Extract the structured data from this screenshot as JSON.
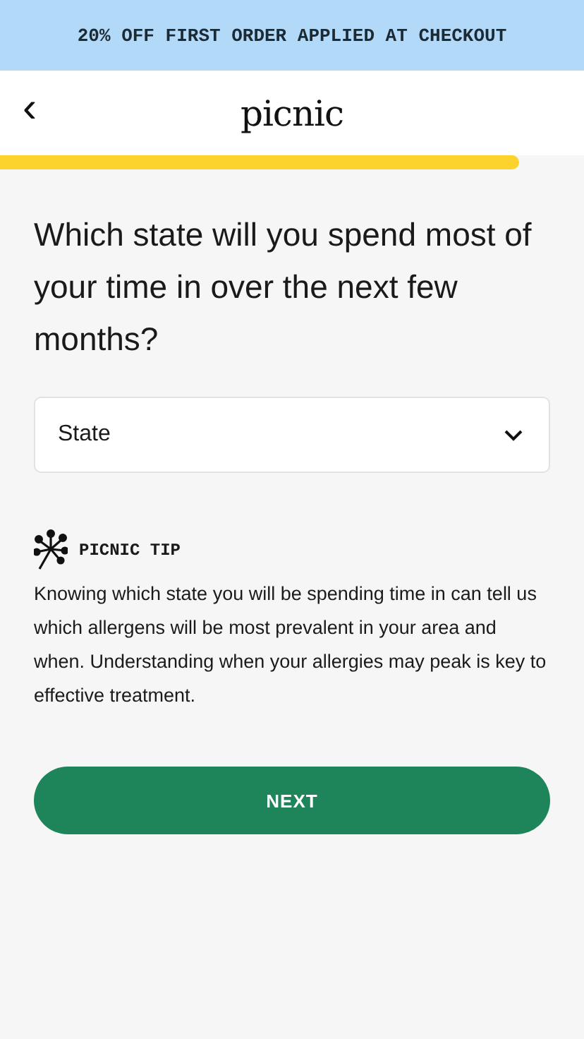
{
  "promo_banner": {
    "text": "20% OFF FIRST ORDER APPLIED AT CHECKOUT"
  },
  "header": {
    "back": "‹",
    "logo": "picnic"
  },
  "progress": {
    "level": 0.89
  },
  "question": "Which state will you spend most of your time in over the next few months?",
  "state_select": {
    "placeholder": "State"
  },
  "tip": {
    "title": "PICNIC TIP",
    "body": "Knowing which state you will be spending time in can tell us which allergens will be most prevalent in your area and when. Understanding when your allergies may peak is key to effective treatment."
  },
  "next_button": {
    "label": "NEXT"
  }
}
